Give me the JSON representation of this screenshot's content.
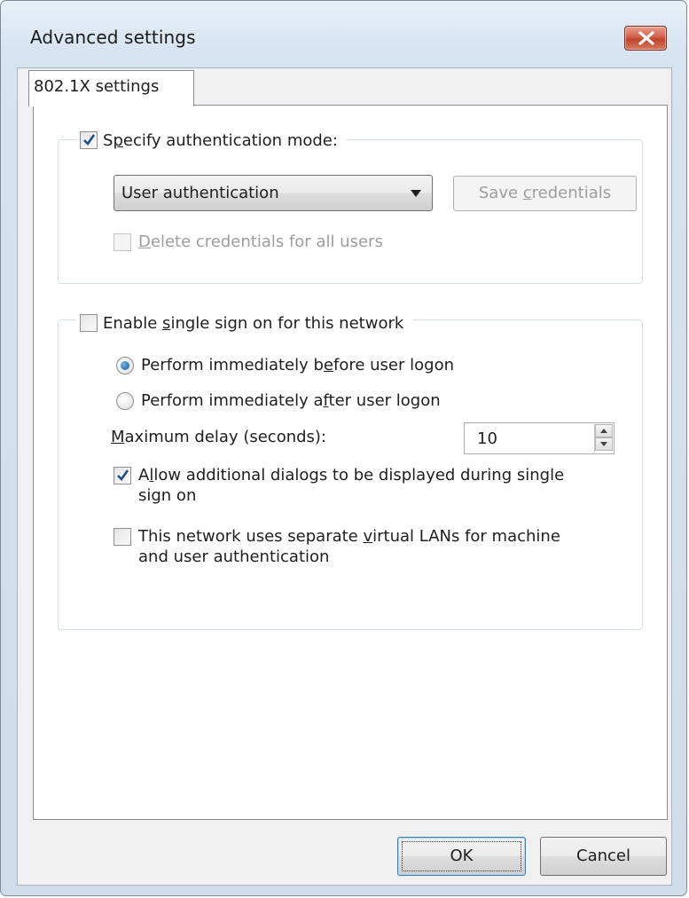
{
  "window": {
    "title": "Advanced settings",
    "close_icon": "close-icon"
  },
  "tabs": [
    {
      "label": "802.1X settings",
      "selected": true
    }
  ],
  "auth_group": {
    "specify_mode": {
      "label_pre": "S",
      "label_accel": "p",
      "label_post": "ecify authentication mode:",
      "checked": true
    },
    "mode_select": {
      "value": "User authentication"
    },
    "save_credentials": {
      "label_pre": "Save ",
      "label_accel": "c",
      "label_post": "redentials",
      "enabled": false
    },
    "delete_credentials": {
      "label_pre": "",
      "label_accel": "D",
      "label_post": "elete credentials for all users",
      "checked": false,
      "enabled": false
    }
  },
  "sso_group": {
    "enable_sso": {
      "label_pre": "Enable ",
      "label_accel": "s",
      "label_post": "ingle sign on for this network",
      "checked": false
    },
    "radio_before": {
      "label_pre": "Perform immediately b",
      "label_accel": "e",
      "label_post": "fore user logon",
      "checked": true
    },
    "radio_after": {
      "label_pre": "Perform immediately a",
      "label_accel": "f",
      "label_post": "ter user logon",
      "checked": false
    },
    "max_delay": {
      "label_pre": "",
      "label_accel": "M",
      "label_post": "aximum delay (seconds):",
      "value": "10"
    },
    "allow_dialogs": {
      "label_pre": "A",
      "label_accel": "l",
      "label_post": "low additional dialogs to be displayed during single sign on",
      "checked": true
    },
    "separate_vlans": {
      "label_pre": "This network uses separate ",
      "label_accel": "v",
      "label_post": "irtual LANs for machine and user authentication",
      "checked": false
    }
  },
  "footer": {
    "ok_label": "OK",
    "cancel_label": "Cancel"
  }
}
